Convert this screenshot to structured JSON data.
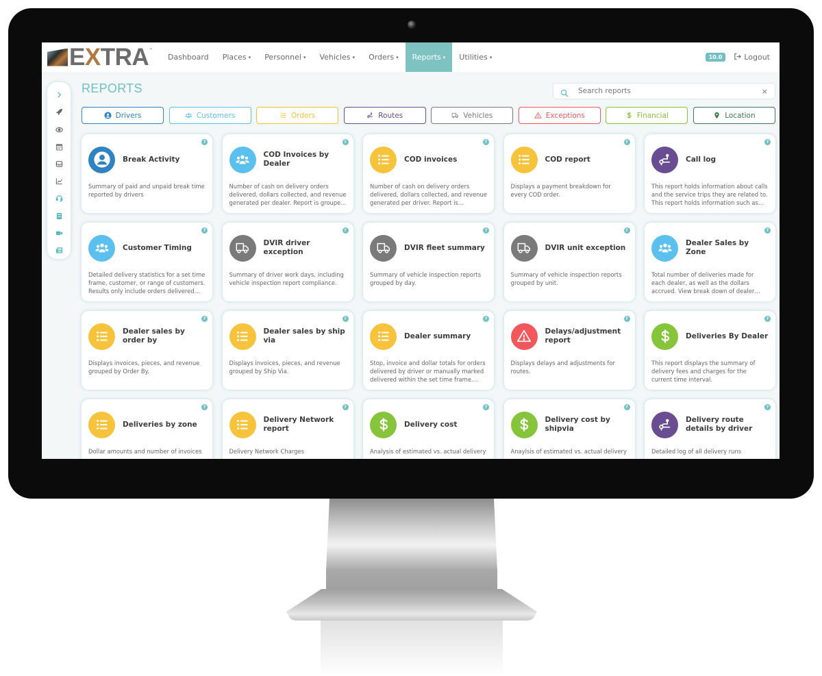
{
  "app": {
    "logo_text_pre": "E",
    "logo_text_x": "X",
    "logo_text_post": "TRA",
    "logo_tm": "™"
  },
  "nav": {
    "items": [
      {
        "label": "Dashboard",
        "dropdown": false,
        "active": false
      },
      {
        "label": "Places",
        "dropdown": true,
        "active": false
      },
      {
        "label": "Personnel",
        "dropdown": true,
        "active": false
      },
      {
        "label": "Vehicles",
        "dropdown": true,
        "active": false
      },
      {
        "label": "Orders",
        "dropdown": true,
        "active": false
      },
      {
        "label": "Reports",
        "dropdown": true,
        "active": true
      },
      {
        "label": "Utilities",
        "dropdown": true,
        "active": false
      }
    ],
    "caret": "▾",
    "version": "10.0",
    "logout_label": "Logout",
    "active_color": "#7fc2c2"
  },
  "rail": {
    "items": [
      {
        "icon": "chevron-right-icon",
        "glyph": "›"
      },
      {
        "icon": "rocket-icon",
        "glyph": "🚀"
      },
      {
        "icon": "eye-icon",
        "glyph": "◉"
      },
      {
        "icon": "calendar-icon",
        "glyph": "▦"
      },
      {
        "icon": "inbox-icon",
        "glyph": "▭"
      },
      {
        "icon": "line-chart-icon",
        "glyph": "⟋"
      },
      {
        "icon": "headset-icon",
        "glyph": "☊"
      },
      {
        "icon": "document-icon",
        "glyph": "▤"
      },
      {
        "icon": "video-camera-icon",
        "glyph": "▶"
      },
      {
        "icon": "newspaper-icon",
        "glyph": "▥"
      }
    ]
  },
  "page": {
    "title": "REPORTS",
    "search": {
      "placeholder": "Search reports",
      "value": "",
      "clear": "×"
    }
  },
  "filters": [
    {
      "label": "Drivers",
      "icon": "user-circle-icon",
      "color": "#2f83c3"
    },
    {
      "label": "Customers",
      "icon": "users-icon",
      "color": "#5cc0ef"
    },
    {
      "label": "Orders",
      "icon": "list-icon",
      "color": "#f7c23c"
    },
    {
      "label": "Routes",
      "icon": "route-icon",
      "color": "#6a4c93"
    },
    {
      "label": "Vehicles",
      "icon": "truck-icon",
      "color": "#7a7a7a"
    },
    {
      "label": "Exceptions",
      "icon": "warning-icon",
      "color": "#f0585b"
    },
    {
      "label": "Financial",
      "icon": "dollar-icon",
      "color": "#86c43b"
    },
    {
      "label": "Location",
      "icon": "map-pin-icon",
      "color": "#3f7a52"
    }
  ],
  "reports": [
    {
      "title": "Break Activity",
      "category": "drivers",
      "desc": "Summary of paid and unpaid break time reported by drivers"
    },
    {
      "title": "COD Invoices by Dealer",
      "category": "customers",
      "desc": "Number of cash on delivery orders delivered, dollars collected, and revenue generated per dealer. Report is groupe..."
    },
    {
      "title": "COD invoices",
      "category": "orders",
      "desc": "Number of cash on delivery orders delivered, dollars collected, and revenue generated per driver. Report is grouped..."
    },
    {
      "title": "COD report",
      "category": "orders",
      "desc": "Displays a payment breakdown for every COD order."
    },
    {
      "title": "Call log",
      "category": "routes",
      "desc": "This report holds information about calls and the service trips they are related to. This report holds information such as c..."
    },
    {
      "title": "Customer Timing",
      "category": "customers",
      "desc": "Detailed delivery statistics for a set time frame, customer, or range of customers. Results only include orders delivered to..."
    },
    {
      "title": "DVIR driver exception",
      "category": "vehicles",
      "desc": "Summary of driver work days, including vehicle inspection report compliance."
    },
    {
      "title": "DVIR fleet summary",
      "category": "vehicles",
      "desc": "Summary of vehicle inspection reports grouped by day."
    },
    {
      "title": "DVIR unit exception",
      "category": "vehicles",
      "desc": "Summary of vehicle inspection reports grouped by unit."
    },
    {
      "title": "Dealer Sales by Zone",
      "category": "customers",
      "desc": "Total number of deliveries made for each dealer, as well as the dollars accrued. View break down of dealer monetary..."
    },
    {
      "title": "Dealer sales by order by",
      "category": "orders",
      "desc": "Displays invoices, pieces, and revenue grouped by Order By."
    },
    {
      "title": "Dealer sales by ship via",
      "category": "orders",
      "desc": "Displays invoices, pieces, and revenue grouped by Ship Via."
    },
    {
      "title": "Dealer summary",
      "category": "orders",
      "desc": "Stop, invoice and dollar totals for orders delivered by driver or manually marked delivered within the set time frame...."
    },
    {
      "title": "Delays/adjustment report",
      "category": "exceptions",
      "desc": "Displays delays and adjustments for routes."
    },
    {
      "title": "Deliveries By Dealer",
      "category": "financial",
      "desc": "This report displays the summary of delivery fees and charges for the current time interval."
    },
    {
      "title": "Deliveries by zone",
      "category": "orders",
      "desc": "Dollar amounts and number of invoices"
    },
    {
      "title": "Delivery Network report",
      "category": "orders",
      "desc": "Delivery Network Charges"
    },
    {
      "title": "Delivery cost",
      "category": "financial",
      "desc": "Analysis of estimated vs. actual delivery"
    },
    {
      "title": "Delivery cost by shipvia",
      "category": "financial",
      "desc": "Anaylsis of estimated vs. actual delivery"
    },
    {
      "title": "Delivery route details by driver",
      "category": "routes",
      "desc": "Detailed log of all delivery runs"
    }
  ],
  "help_glyph": "?"
}
